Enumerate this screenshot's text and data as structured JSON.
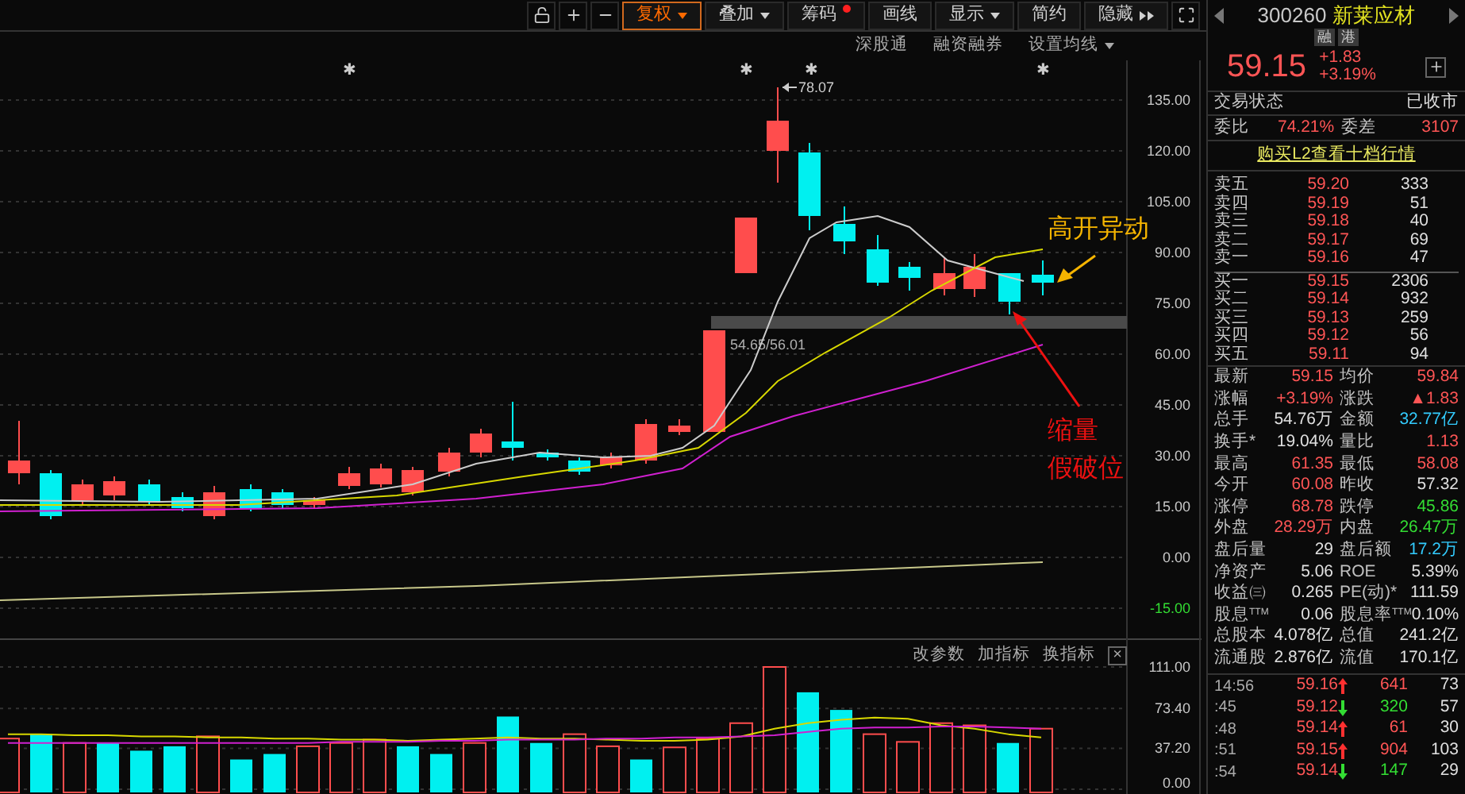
{
  "toolbar": {
    "buttons": [
      {
        "label": "复权",
        "kind": "dropdown",
        "selected": true,
        "dot": false
      },
      {
        "label": "叠加",
        "kind": "dropdown",
        "selected": false,
        "dot": false
      },
      {
        "label": "筹码",
        "kind": "plain",
        "selected": false,
        "dot": true
      },
      {
        "label": "画线",
        "kind": "plain",
        "selected": false,
        "dot": false
      },
      {
        "label": "显示",
        "kind": "dropdown",
        "selected": false,
        "dot": false
      },
      {
        "label": "简约",
        "kind": "plain",
        "selected": false,
        "dot": false
      },
      {
        "label": "隐藏",
        "kind": "expand",
        "selected": false,
        "dot": false
      }
    ],
    "sub_links": [
      {
        "label": "深股通",
        "kind": "plain"
      },
      {
        "label": "融资融券",
        "kind": "plain"
      },
      {
        "label": "设置均线",
        "kind": "dropdown"
      }
    ]
  },
  "chart": {
    "markers": [
      "✱",
      "✱",
      "✱",
      "✱"
    ],
    "high_marker": "78.07",
    "band_label": "54.65/56.01",
    "price_axis": [
      {
        "label": "135.00",
        "color": "#c8c8c8"
      },
      {
        "label": "120.00",
        "color": "#c8c8c8"
      },
      {
        "label": "105.00",
        "color": "#c8c8c8"
      },
      {
        "label": "90.00",
        "color": "#c8c8c8"
      },
      {
        "label": "75.00",
        "color": "#c8c8c8"
      },
      {
        "label": "60.00",
        "color": "#c8c8c8"
      },
      {
        "label": "45.00",
        "color": "#c8c8c8"
      },
      {
        "label": "30.00",
        "color": "#c8c8c8"
      },
      {
        "label": "15.00",
        "color": "#c8c8c8"
      },
      {
        "label": "0.00",
        "color": "#c8c8c8"
      },
      {
        "label": "-15.00",
        "color": "#33dd33"
      }
    ],
    "annotations": [
      {
        "lines": [
          "高开异动"
        ],
        "color": "#f5b400"
      },
      {
        "lines": [
          "缩量",
          "假破位"
        ],
        "color": "#ee1111"
      }
    ]
  },
  "volume": {
    "tools": [
      "改参数",
      "加指标",
      "换指标"
    ],
    "close": "×",
    "chart_data": {
      "type": "bar",
      "ylim": [
        0,
        111
      ],
      "yticks": [
        {
          "value": 111,
          "label": "111.00"
        },
        {
          "value": 73.4,
          "label": "73.40"
        },
        {
          "value": 37.2,
          "label": "37.20"
        },
        {
          "value": 0,
          "label": "0.00"
        }
      ],
      "series": [
        {
          "type": "bar",
          "color": "#ff4d4d",
          "values": [
            46,
            null,
            42,
            null,
            null,
            null,
            48,
            null,
            null,
            39,
            42,
            45,
            null,
            null,
            42,
            null,
            null,
            50,
            39,
            null,
            38,
            46,
            60,
            111,
            null,
            null,
            50,
            43,
            60,
            58,
            null,
            55
          ]
        },
        {
          "type": "bar",
          "color": "#00f0f0",
          "values": [
            null,
            50,
            null,
            42,
            35,
            39,
            null,
            27,
            32,
            null,
            null,
            null,
            39,
            32,
            null,
            66,
            42,
            null,
            null,
            27,
            null,
            null,
            null,
            null,
            88,
            72,
            null,
            null,
            null,
            null,
            42,
            null
          ]
        },
        {
          "type": "line",
          "color": "#d8d800",
          "values": [
            50,
            50,
            49,
            49,
            48,
            48,
            47,
            47,
            46,
            46,
            45,
            45,
            44,
            45,
            46,
            47,
            46,
            46,
            45,
            44,
            44,
            45,
            48,
            55,
            60,
            63,
            65,
            64,
            58,
            55,
            50,
            47
          ]
        },
        {
          "type": "line",
          "color": "#d020d0",
          "values": [
            42,
            42,
            42,
            42,
            42,
            42,
            42,
            42,
            42,
            42,
            43,
            43,
            43,
            44,
            44,
            45,
            45,
            45,
            46,
            46,
            47,
            47,
            48,
            49,
            52,
            55,
            56,
            56,
            57,
            57,
            56,
            55
          ]
        }
      ]
    }
  },
  "quote": {
    "code": "300260",
    "name": "新莱应材",
    "badges": [
      "融",
      "港"
    ],
    "price": "59.15",
    "change": "+1.83",
    "change_pct": "+3.19%",
    "status_label": "交易状态",
    "status_value": "已收市",
    "ratio_label": "委比",
    "ratio_value": "74.21%",
    "diff_label": "委差",
    "diff_value": "3107",
    "l2_link": "购买L2查看十档行情",
    "asks": [
      {
        "label": "卖五",
        "price": "59.20",
        "volume": "333"
      },
      {
        "label": "卖四",
        "price": "59.19",
        "volume": "51"
      },
      {
        "label": "卖三",
        "price": "59.18",
        "volume": "40"
      },
      {
        "label": "卖二",
        "price": "59.17",
        "volume": "69"
      },
      {
        "label": "卖一",
        "price": "59.16",
        "volume": "47"
      }
    ],
    "bids": [
      {
        "label": "买一",
        "price": "59.15",
        "volume": "2306"
      },
      {
        "label": "买二",
        "price": "59.14",
        "volume": "932"
      },
      {
        "label": "买三",
        "price": "59.13",
        "volume": "259"
      },
      {
        "label": "买四",
        "price": "59.12",
        "volume": "56"
      },
      {
        "label": "买五",
        "price": "59.11",
        "volume": "94"
      }
    ],
    "stats": [
      {
        "label": "最新",
        "value": "59.15",
        "color": "#ff5555"
      },
      {
        "label": "均价",
        "value": "59.84",
        "color": "#ff5555"
      },
      {
        "label": "涨幅",
        "value": "+3.19%",
        "color": "#ff5555"
      },
      {
        "label": "涨跌",
        "value": "▲1.83",
        "color": "#ff5555"
      },
      {
        "label": "总手",
        "value": "54.76万",
        "color": "#e0e0e0"
      },
      {
        "label": "金额",
        "value": "32.77亿",
        "color": "#33ccff"
      },
      {
        "label": "换手*",
        "value": "19.04%",
        "color": "#e0e0e0"
      },
      {
        "label": "量比",
        "value": "1.13",
        "color": "#ff5555"
      },
      {
        "label": "最高",
        "value": "61.35",
        "color": "#ff5555"
      },
      {
        "label": "最低",
        "value": "58.08",
        "color": "#ff5555"
      },
      {
        "label": "今开",
        "value": "60.08",
        "color": "#ff5555"
      },
      {
        "label": "昨收",
        "value": "57.32",
        "color": "#e0e0e0"
      },
      {
        "label": "涨停",
        "value": "68.78",
        "color": "#ff5555"
      },
      {
        "label": "跌停",
        "value": "45.86",
        "color": "#33dd33"
      },
      {
        "label": "外盘",
        "value": "28.29万",
        "color": "#ff5555"
      },
      {
        "label": "内盘",
        "value": "26.47万",
        "color": "#33dd33"
      },
      {
        "label": "盘后量",
        "value": "29",
        "color": "#e0e0e0"
      },
      {
        "label": "盘后额",
        "value": "17.2万",
        "color": "#33ccff"
      },
      {
        "label": "净资产",
        "value": "5.06",
        "color": "#e0e0e0"
      },
      {
        "label": "ROE",
        "value": "5.39%",
        "color": "#e0e0e0"
      },
      {
        "label": "收益㈢",
        "value": "0.265",
        "color": "#e0e0e0"
      },
      {
        "label": "PE(动)*",
        "value": "111.59",
        "color": "#e0e0e0"
      },
      {
        "label": "股息$^{TTM}$",
        "value": "0.06",
        "color": "#e0e0e0"
      },
      {
        "label": "股息率$^{TTM}$",
        "value": "0.10%",
        "color": "#e0e0e0"
      },
      {
        "label": "总股本",
        "value": "4.078亿",
        "color": "#e0e0e0"
      },
      {
        "label": "总值",
        "value": "241.2亿",
        "color": "#e0e0e0"
      },
      {
        "label": "流通股",
        "value": "2.876亿",
        "color": "#e0e0e0"
      },
      {
        "label": "流值",
        "value": "170.1亿",
        "color": "#e0e0e0"
      }
    ],
    "ticks": [
      {
        "time": "14:56",
        "price": "59.16",
        "rising": true,
        "volume": "641",
        "count": "73"
      },
      {
        "time": ":45",
        "price": "59.12",
        "rising": false,
        "volume": "320",
        "count": "57"
      },
      {
        "time": ":48",
        "price": "59.14",
        "rising": true,
        "volume": "61",
        "count": "30"
      },
      {
        "time": ":51",
        "price": "59.15",
        "rising": true,
        "volume": "904",
        "count": "103"
      },
      {
        "time": ":54",
        "price": "59.14",
        "rising": false,
        "volume": "147",
        "count": "29"
      }
    ]
  }
}
